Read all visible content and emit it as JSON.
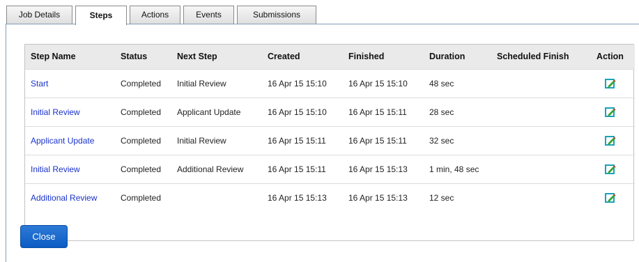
{
  "tabs": [
    {
      "label": "Job Details",
      "active": false
    },
    {
      "label": "Steps",
      "active": true
    },
    {
      "label": "Actions",
      "active": false
    },
    {
      "label": "Events",
      "active": false
    },
    {
      "label": "Submissions",
      "active": false
    }
  ],
  "table": {
    "columns": [
      "Step Name",
      "Status",
      "Next Step",
      "Created",
      "Finished",
      "Duration",
      "Scheduled Finish",
      "Action"
    ],
    "rows": [
      {
        "step_name": "Start",
        "status": "Completed",
        "next_step": "Initial Review",
        "created": "16 Apr 15 15:10",
        "finished": "16 Apr 15 15:10",
        "duration": "48 sec",
        "scheduled_finish": "",
        "action_icon": "edit-icon"
      },
      {
        "step_name": "Initial Review",
        "status": "Completed",
        "next_step": "Applicant Update",
        "created": "16 Apr 15 15:10",
        "finished": "16 Apr 15 15:11",
        "duration": "28 sec",
        "scheduled_finish": "",
        "action_icon": "edit-icon"
      },
      {
        "step_name": "Applicant Update",
        "status": "Completed",
        "next_step": "Initial Review",
        "created": "16 Apr 15 15:11",
        "finished": "16 Apr 15 15:11",
        "duration": "32 sec",
        "scheduled_finish": "",
        "action_icon": "edit-icon"
      },
      {
        "step_name": "Initial Review",
        "status": "Completed",
        "next_step": "Additional Review",
        "created": "16 Apr 15 15:11",
        "finished": "16 Apr 15 15:13",
        "duration": "1 min, 48 sec",
        "scheduled_finish": "",
        "action_icon": "edit-icon"
      },
      {
        "step_name": "Additional Review",
        "status": "Completed",
        "next_step": "",
        "created": "16 Apr 15 15:13",
        "finished": "16 Apr 15 15:13",
        "duration": "12 sec",
        "scheduled_finish": "",
        "action_icon": "edit-icon"
      }
    ]
  },
  "close_button": {
    "label": "Close"
  },
  "colors": {
    "link": "#1a33cc",
    "header_bg": "#eaeaea",
    "button": "#0b5cc4",
    "icon_frame": "#1aa3b8",
    "icon_pencil": "#3aa33a"
  }
}
